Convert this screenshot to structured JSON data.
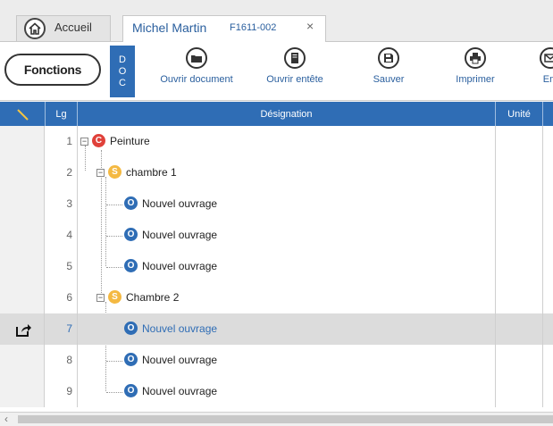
{
  "tabs": {
    "home": {
      "label": "Accueil",
      "icon": "home-icon"
    },
    "document": {
      "title": "Michel Martin",
      "code": "F1611-002",
      "close": "×"
    }
  },
  "toolbar": {
    "fonctions": "Fonctions",
    "doc_strip": [
      "D",
      "O",
      "C"
    ],
    "buttons": [
      {
        "label": "Ouvrir document",
        "icon": "folder-icon"
      },
      {
        "label": "Ouvrir entête",
        "icon": "document-icon"
      },
      {
        "label": "Sauver",
        "icon": "save-icon"
      },
      {
        "label": "Imprimer",
        "icon": "printer-icon"
      },
      {
        "label": "Em",
        "icon": "email-icon"
      }
    ]
  },
  "grid": {
    "columns": {
      "lg": "Lg",
      "designation": "Désignation",
      "unite": "Unité"
    },
    "rows": [
      {
        "lg": "1",
        "type": "C",
        "label": "Peinture"
      },
      {
        "lg": "2",
        "type": "S",
        "label": "chambre 1"
      },
      {
        "lg": "3",
        "type": "O",
        "label": "Nouvel ouvrage"
      },
      {
        "lg": "4",
        "type": "O",
        "label": "Nouvel ouvrage"
      },
      {
        "lg": "5",
        "type": "O",
        "label": "Nouvel ouvrage"
      },
      {
        "lg": "6",
        "type": "S",
        "label": "Chambre 2"
      },
      {
        "lg": "7",
        "type": "O",
        "label": "Nouvel ouvrage",
        "selected": true
      },
      {
        "lg": "8",
        "type": "O",
        "label": "Nouvel ouvrage"
      },
      {
        "lg": "9",
        "type": "O",
        "label": "Nouvel ouvrage"
      }
    ]
  },
  "scrollbar": {
    "left_arrow": "‹"
  },
  "colors": {
    "accent": "#2f6db5",
    "chapter": "#e0413a",
    "section": "#f4b942"
  }
}
